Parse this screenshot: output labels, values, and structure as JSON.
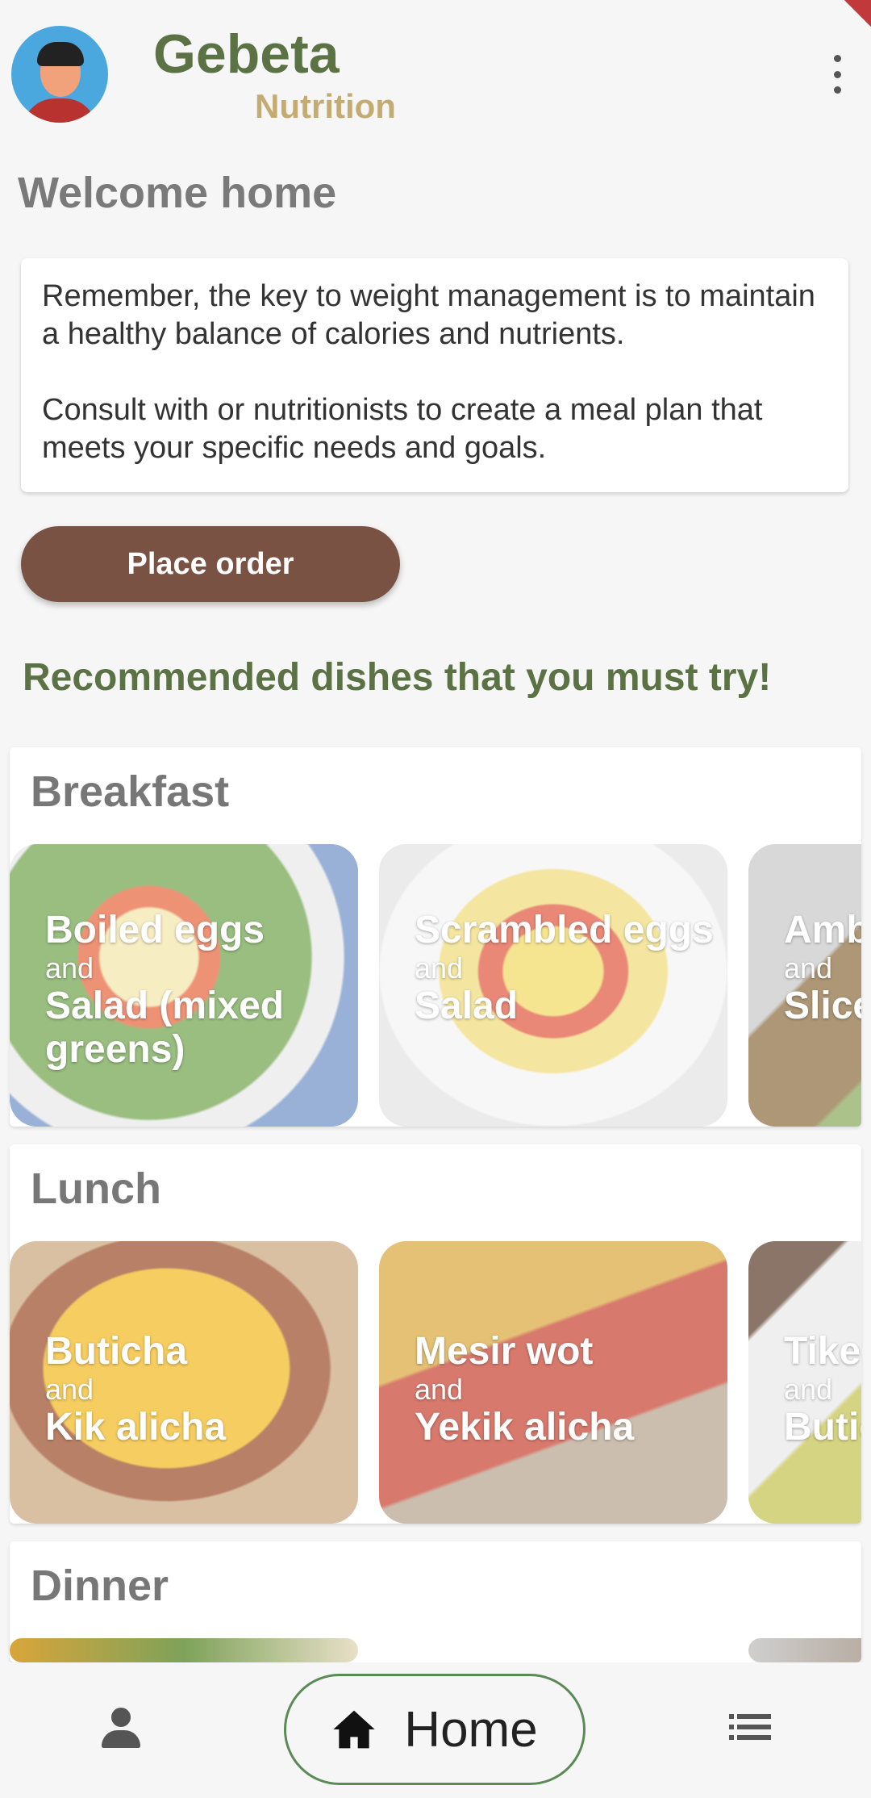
{
  "header": {
    "brand_title": "Gebeta",
    "brand_subtitle": "Nutrition",
    "avatar_icon": "user-avatar",
    "menu_icon": "more-vert-icon"
  },
  "welcome": "Welcome home",
  "tip": {
    "text": "Remember, the key to weight management is to maintain a healthy balance of calories and nutrients.\n\n Consult with or nutritionists to create a meal plan that meets your specific needs and goals."
  },
  "order_button": "Place order",
  "recommend_title": "Recommended dishes that you must try!",
  "meals": {
    "breakfast": {
      "title": "Breakfast",
      "dishes": [
        {
          "main1": "Boiled eggs",
          "and": "and",
          "main2": "Salad (mixed greens)"
        },
        {
          "main1": "Scrambled eggs",
          "and": "and",
          "main2": "Salad"
        },
        {
          "main1": "Amb",
          "and": "and",
          "main2": "Slice avoc"
        }
      ]
    },
    "lunch": {
      "title": "Lunch",
      "dishes": [
        {
          "main1": "Buticha",
          "and": "and",
          "main2": "Kik alicha"
        },
        {
          "main1": "Mesir wot",
          "and": "and",
          "main2": "Yekik alicha"
        },
        {
          "main1": "Tike",
          "and": "and",
          "main2": "Butic"
        }
      ]
    },
    "dinner": {
      "title": "Dinner"
    }
  },
  "bottom_nav": {
    "home_label": "Home",
    "profile_icon": "person-icon",
    "home_icon": "home-icon",
    "list_icon": "list-icon"
  },
  "colors": {
    "brand_green": "#5a7244",
    "brand_gold": "#c4ab72",
    "button_brown": "#7a5244",
    "nav_outline": "#5a8a55"
  }
}
